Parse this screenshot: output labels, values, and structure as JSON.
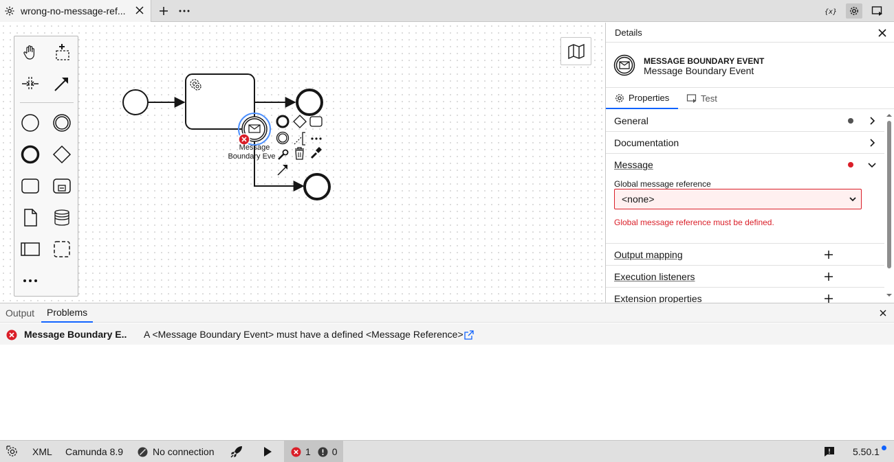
{
  "tab": {
    "title": "wrong-no-message-ref...",
    "icon": "gear-icon"
  },
  "toolbar_right": [
    "variables-icon",
    "settings-icon",
    "deploy-screen-icon"
  ],
  "palette": {
    "tools": [
      "hand-tool-icon",
      "lasso-tool-icon",
      "space-tool-icon",
      "connect-tool-icon"
    ],
    "elements": [
      "start-event-icon",
      "intermediate-event-icon",
      "end-event-icon",
      "gateway-icon",
      "task-icon",
      "subprocess-icon",
      "data-object-icon",
      "data-store-icon",
      "pool-icon",
      "group-icon"
    ],
    "more": "more-icon"
  },
  "diagram": {
    "boundary_label_1": "Message",
    "boundary_label_2": "Boundary Eve"
  },
  "details": {
    "header": "Details",
    "element_type": "MESSAGE BOUNDARY EVENT",
    "element_name": "Message Boundary Event",
    "tabs": {
      "properties": "Properties",
      "test": "Test"
    },
    "groups": {
      "general": "General",
      "documentation": "Documentation",
      "message": "Message",
      "output_mapping": "Output mapping",
      "execution_listeners": "Execution listeners",
      "extension_properties": "Extension properties"
    },
    "message_field": {
      "label": "Global message reference",
      "value": "<none>",
      "error": "Global message reference must be defined."
    },
    "colors": {
      "error": "#da1e28",
      "dot": "#525252",
      "accent": "#0f62fe"
    }
  },
  "bottom_panel": {
    "tabs": {
      "output": "Output",
      "problems": "Problems"
    },
    "problem": {
      "element": "Message Boundary E...",
      "message": "A <Message Boundary Event> must have a defined <Message Reference>"
    }
  },
  "status_bar": {
    "xml": "XML",
    "engine": "Camunda 8.9",
    "connection": "No connection",
    "errors": "1",
    "warnings": "0",
    "version": "5.50.1"
  }
}
